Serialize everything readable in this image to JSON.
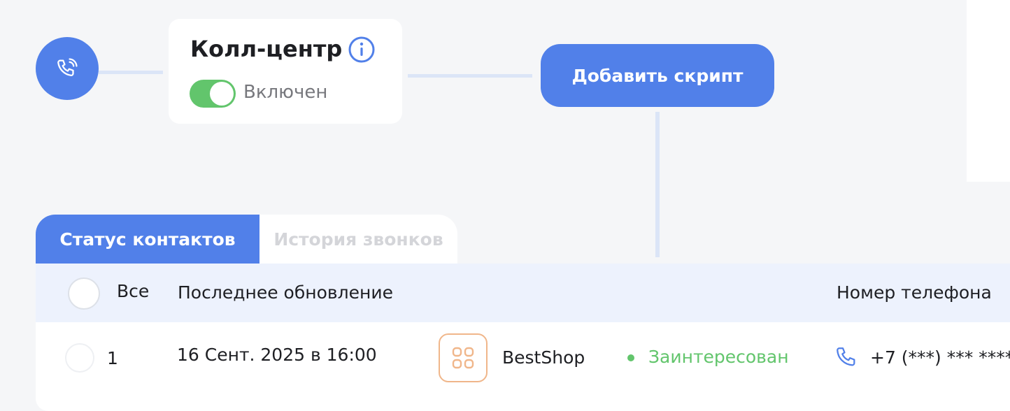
{
  "flow": {
    "start_node_icon": "phone-call-icon",
    "callcenter": {
      "title": "Колл-центр",
      "info_icon": "info-icon",
      "toggle_on": true,
      "toggle_label": "Включен"
    },
    "add_script_label": "Добавить скрипт"
  },
  "tabs": [
    {
      "label": "Статус контактов",
      "active": true
    },
    {
      "label": "История звонков",
      "active": false
    }
  ],
  "table": {
    "headers": {
      "all": "Все",
      "updated": "Последнее обновление",
      "phone": "Номер телефона"
    },
    "rows": [
      {
        "number": "1",
        "updated": "16 Сент. 2025 в 16:00",
        "store_icon": "grid-icon",
        "store": "BestShop",
        "status": "Заинтересован",
        "phone_icon": "phone-icon",
        "phone": "+7 (***) *** ****"
      }
    ]
  },
  "colors": {
    "accent": "#5180e9",
    "success": "#62c56c",
    "store_icon_border": "#f0b68a",
    "header_bg": "#edf2fd",
    "page_bg": "#f5f6f8"
  }
}
